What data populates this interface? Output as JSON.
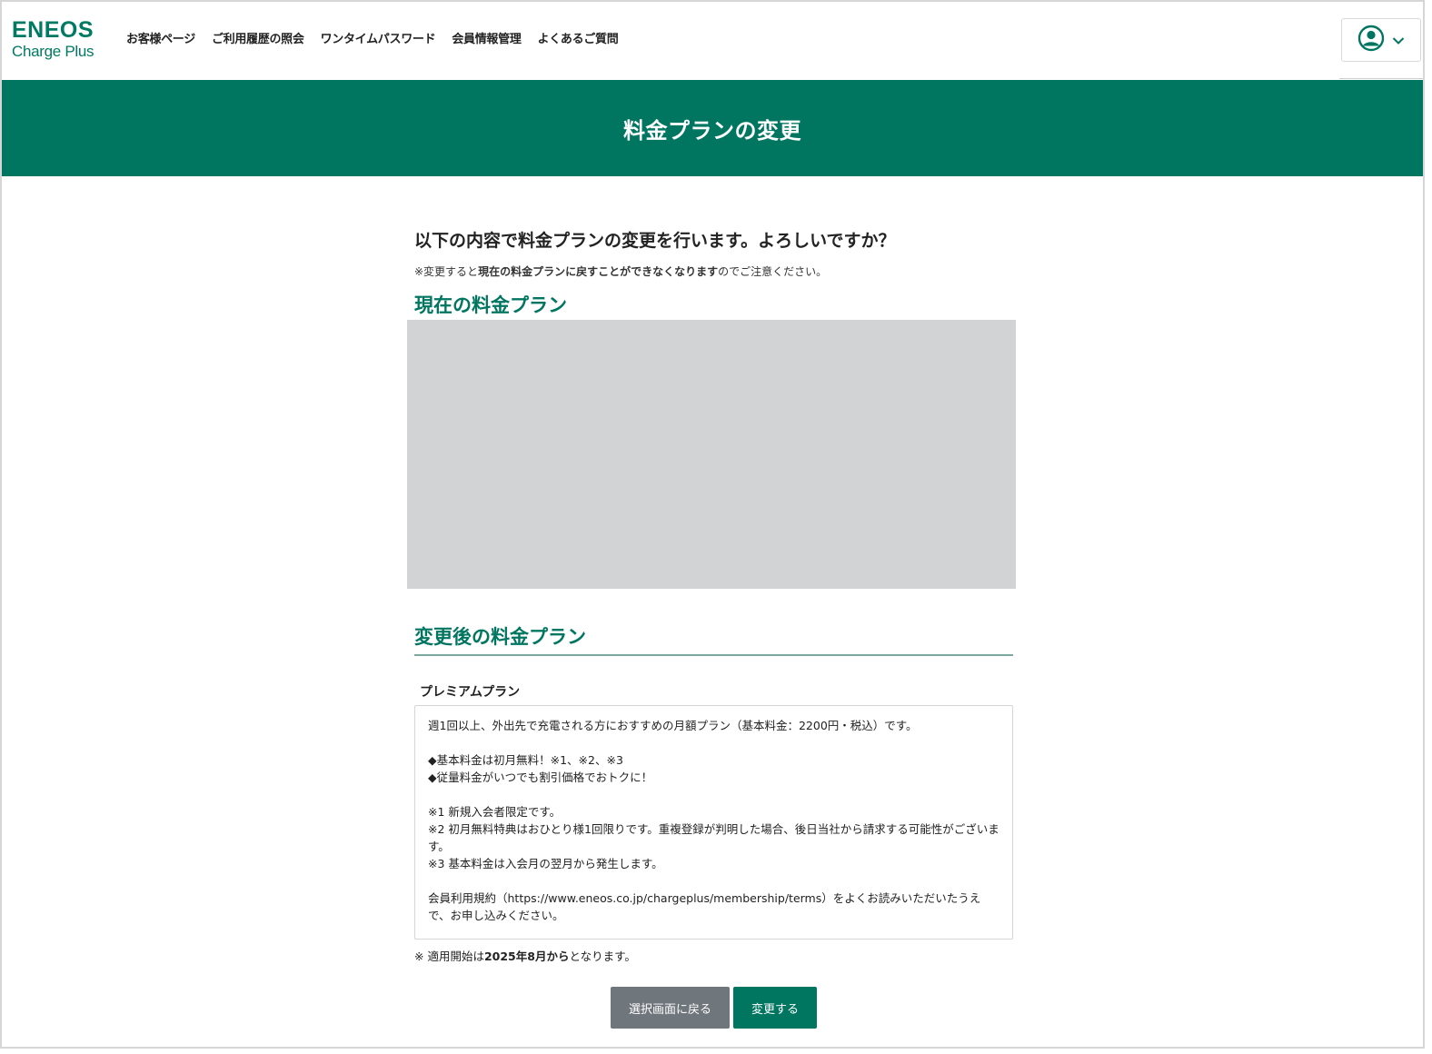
{
  "header": {
    "logo_top": "ENEOS",
    "logo_bottom": "Charge Plus",
    "nav": [
      {
        "label": "お客様ページ"
      },
      {
        "label": "ご利用履歴の照会"
      },
      {
        "label": "ワンタイムパスワード"
      },
      {
        "label": "会員情報管理"
      },
      {
        "label": "よくあるご質問"
      }
    ],
    "user_menu_icon": "user-circle-icon"
  },
  "banner": {
    "title": "料金プランの変更"
  },
  "main": {
    "question": "以下の内容で料金プランの変更を行います。よろしいですか？",
    "notice_pre": "※変更すると",
    "notice_bold": "現在の料金プランに戻すことができなくなります",
    "notice_post": "のでご注意ください。",
    "current_plan_title": "現在の料金プラン",
    "new_plan_title": "変更後の料金プラン",
    "new_plan_name": "プレミアムプラン",
    "new_plan_description": "週1回以上、外出先で充電される方におすすめの月額プラン（基本料金：2200円・税込）です。\n\n◆基本料金は初月無料！※1、※2、※3\n◆従量料金がいつでも割引価格でおトクに！\n\n※1 新規入会者限定です。\n※2 初月無料特典はおひとり様1回限りです。重複登録が判明した場合、後日当社から請求する可能性がございます。\n※3 基本料金は入会月の翌月から発生します。\n\n会員利用規約（https://www.eneos.co.jp/chargeplus/membership/terms）をよくお読みいただいたうえで、お申し込みください。",
    "start_note_pre": "※ 適用開始は",
    "start_note_bold": "2025年8月から",
    "start_note_post": "となります。"
  },
  "actions": {
    "back_label": "選択画面に戻る",
    "change_label": "変更する"
  },
  "colors": {
    "brand": "#007661",
    "back_button": "#6f767c",
    "placeholder": "#d2d3d5"
  }
}
